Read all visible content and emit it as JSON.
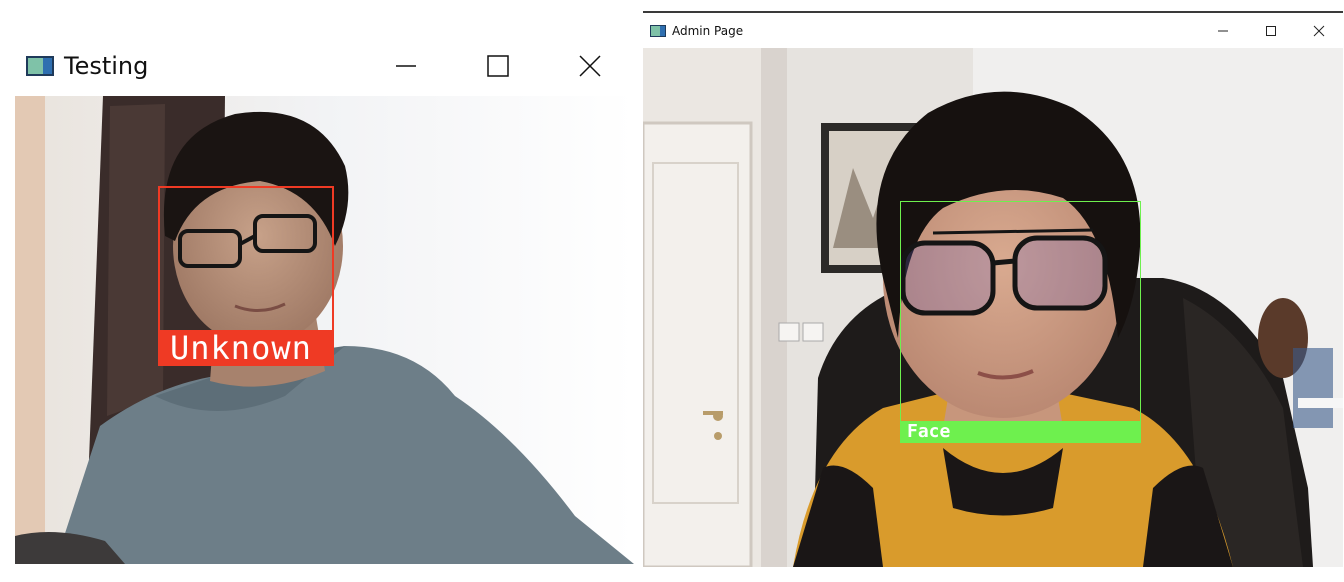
{
  "windows": [
    {
      "title": "Testing",
      "icon": "opencv-window-icon",
      "controls": [
        "minimize",
        "maximize",
        "close"
      ],
      "detection": {
        "label": "Unknown",
        "color": "#ef3a24"
      }
    },
    {
      "title": "Admin Page",
      "icon": "opencv-window-icon",
      "controls": [
        "minimize",
        "maximize",
        "close"
      ],
      "detection": {
        "label": "Face",
        "color": "#6ef04e"
      }
    }
  ]
}
